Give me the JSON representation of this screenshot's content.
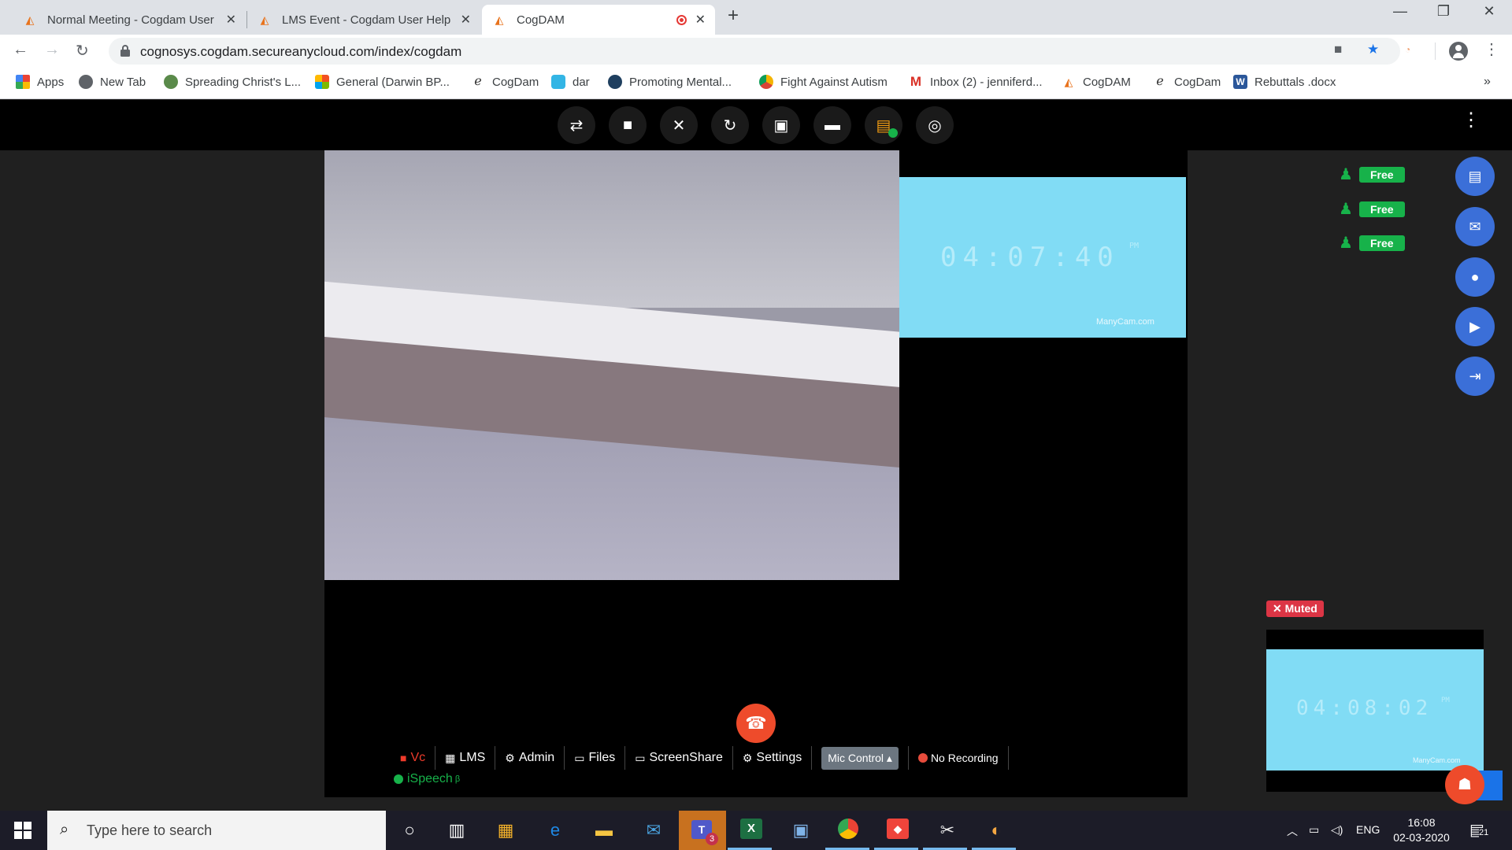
{
  "browser": {
    "tabs": [
      {
        "title": "Normal Meeting - Cogdam User H",
        "active": false
      },
      {
        "title": "LMS Event - Cogdam User Help M",
        "active": false
      },
      {
        "title": "CogDAM",
        "active": true
      }
    ],
    "url": "cognosys.cogdam.secureanycloud.com/index/cogdam",
    "bookmarks": [
      {
        "label": "Apps"
      },
      {
        "label": "New Tab"
      },
      {
        "label": "Spreading Christ's L..."
      },
      {
        "label": "General (Darwin BP..."
      },
      {
        "label": "CogDam"
      },
      {
        "label": "dar"
      },
      {
        "label": "Promoting Mental..."
      },
      {
        "label": "Fight Against Autism"
      },
      {
        "label": "Inbox (2) - jenniferd..."
      },
      {
        "label": "CogDAM"
      },
      {
        "label": "CogDam"
      },
      {
        "label": "Rebuttals .docx"
      }
    ],
    "more_bookmarks": "»"
  },
  "meeting": {
    "pip_clock": "04:07:40",
    "pip_ampm": "PM",
    "pip_watermark": "ManyCam.com",
    "self_clock": "04:08:02",
    "self_ampm": "PM",
    "self_watermark": "ManyCam.com",
    "muted_label": "Muted",
    "free_slots": [
      "Free",
      "Free",
      "Free"
    ],
    "bottom_bar": {
      "vc": "Vc",
      "lms": "LMS",
      "admin": "Admin",
      "files": "Files",
      "screenshare": "ScreenShare",
      "settings": "Settings",
      "mic_control": "Mic Control",
      "recording": "No Recording"
    },
    "ispeech": "iSpeech",
    "ispeech_sup": "β"
  },
  "taskbar": {
    "search_placeholder": "Type here to search",
    "teams_badge": "3",
    "lang": "ENG",
    "time": "16:08",
    "date": "02-03-2020",
    "notifications": "21"
  }
}
